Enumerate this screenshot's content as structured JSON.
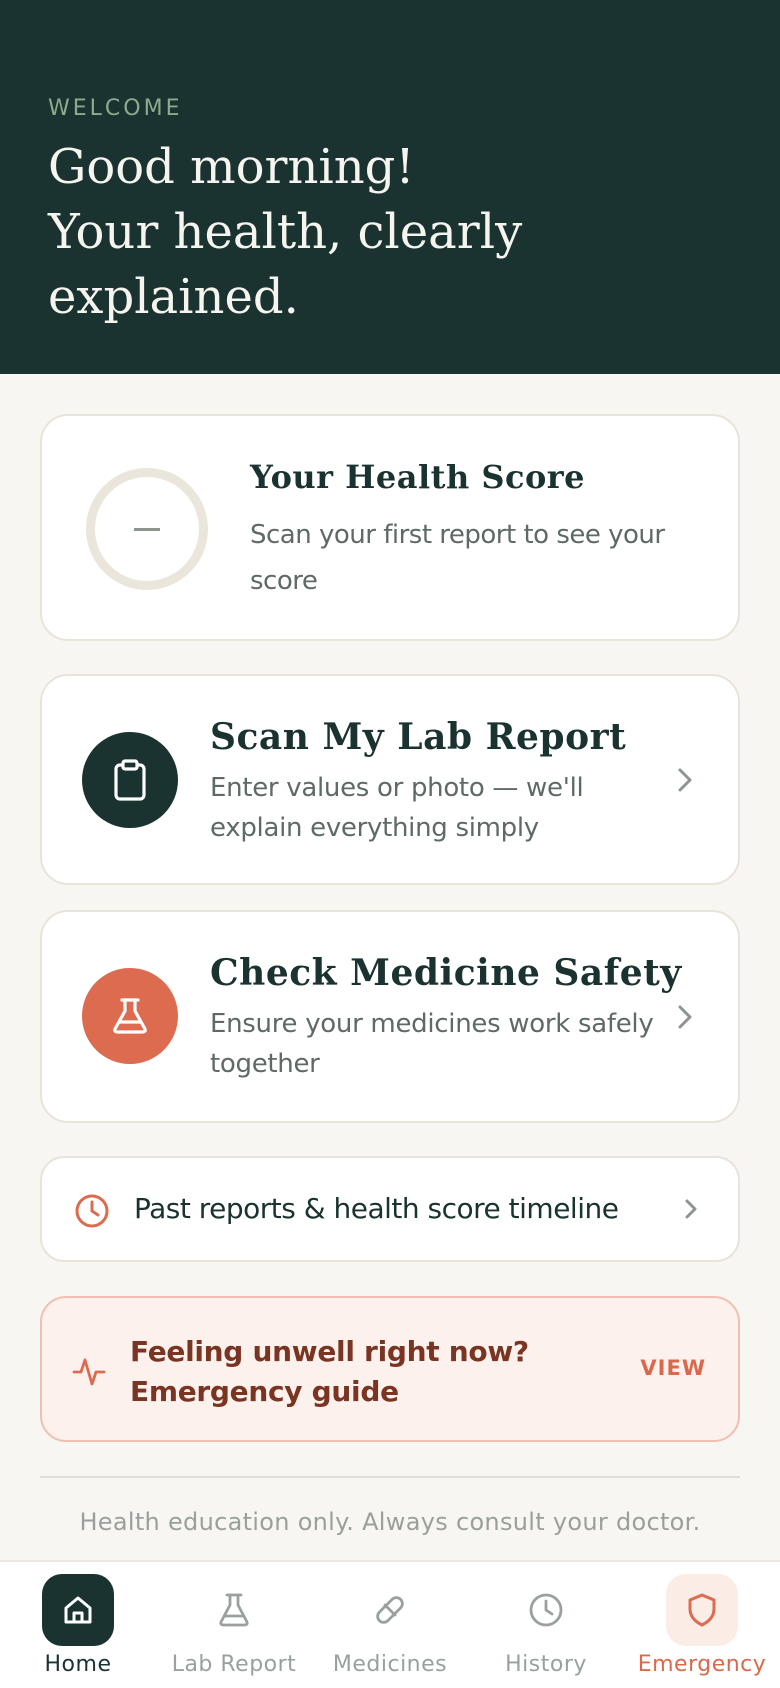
{
  "hero": {
    "eyebrow": "WELCOME",
    "line1": "Good morning!",
    "line2": "Your health, clearly",
    "line3": "explained."
  },
  "health_score": {
    "title": "Your Health Score",
    "subtitle": "Scan your first report to see your score",
    "value": "–",
    "ring_color": "#eae6db"
  },
  "actions": [
    {
      "title": "Scan My Lab Report",
      "subtitle": "Enter values or photo — we'll explain everything simply",
      "icon": "clipboard-icon",
      "color": "#1b3330"
    },
    {
      "title": "Check Medicine Safety",
      "subtitle": "Ensure your medicines work safely together",
      "icon": "flask-icon",
      "color": "#dd6b50"
    }
  ],
  "history_link": {
    "label": "Past reports & health score timeline",
    "icon": "clock-icon"
  },
  "emergency_banner": {
    "text": "Feeling unwell right now? Emergency guide",
    "action": "VIEW",
    "icon": "pulse-icon"
  },
  "disclaimer": "Health education only. Always consult your doctor.",
  "tabs": [
    {
      "label": "Home",
      "icon": "home-icon",
      "active": true
    },
    {
      "label": "Lab Report",
      "icon": "flask-icon"
    },
    {
      "label": "Medicines",
      "icon": "pill-icon"
    },
    {
      "label": "History",
      "icon": "clock-icon"
    },
    {
      "label": "Emergency",
      "icon": "shield-icon"
    }
  ],
  "colors": {
    "primary": "#1b3330",
    "accent": "#dd6b50",
    "background": "#f8f6f2"
  }
}
